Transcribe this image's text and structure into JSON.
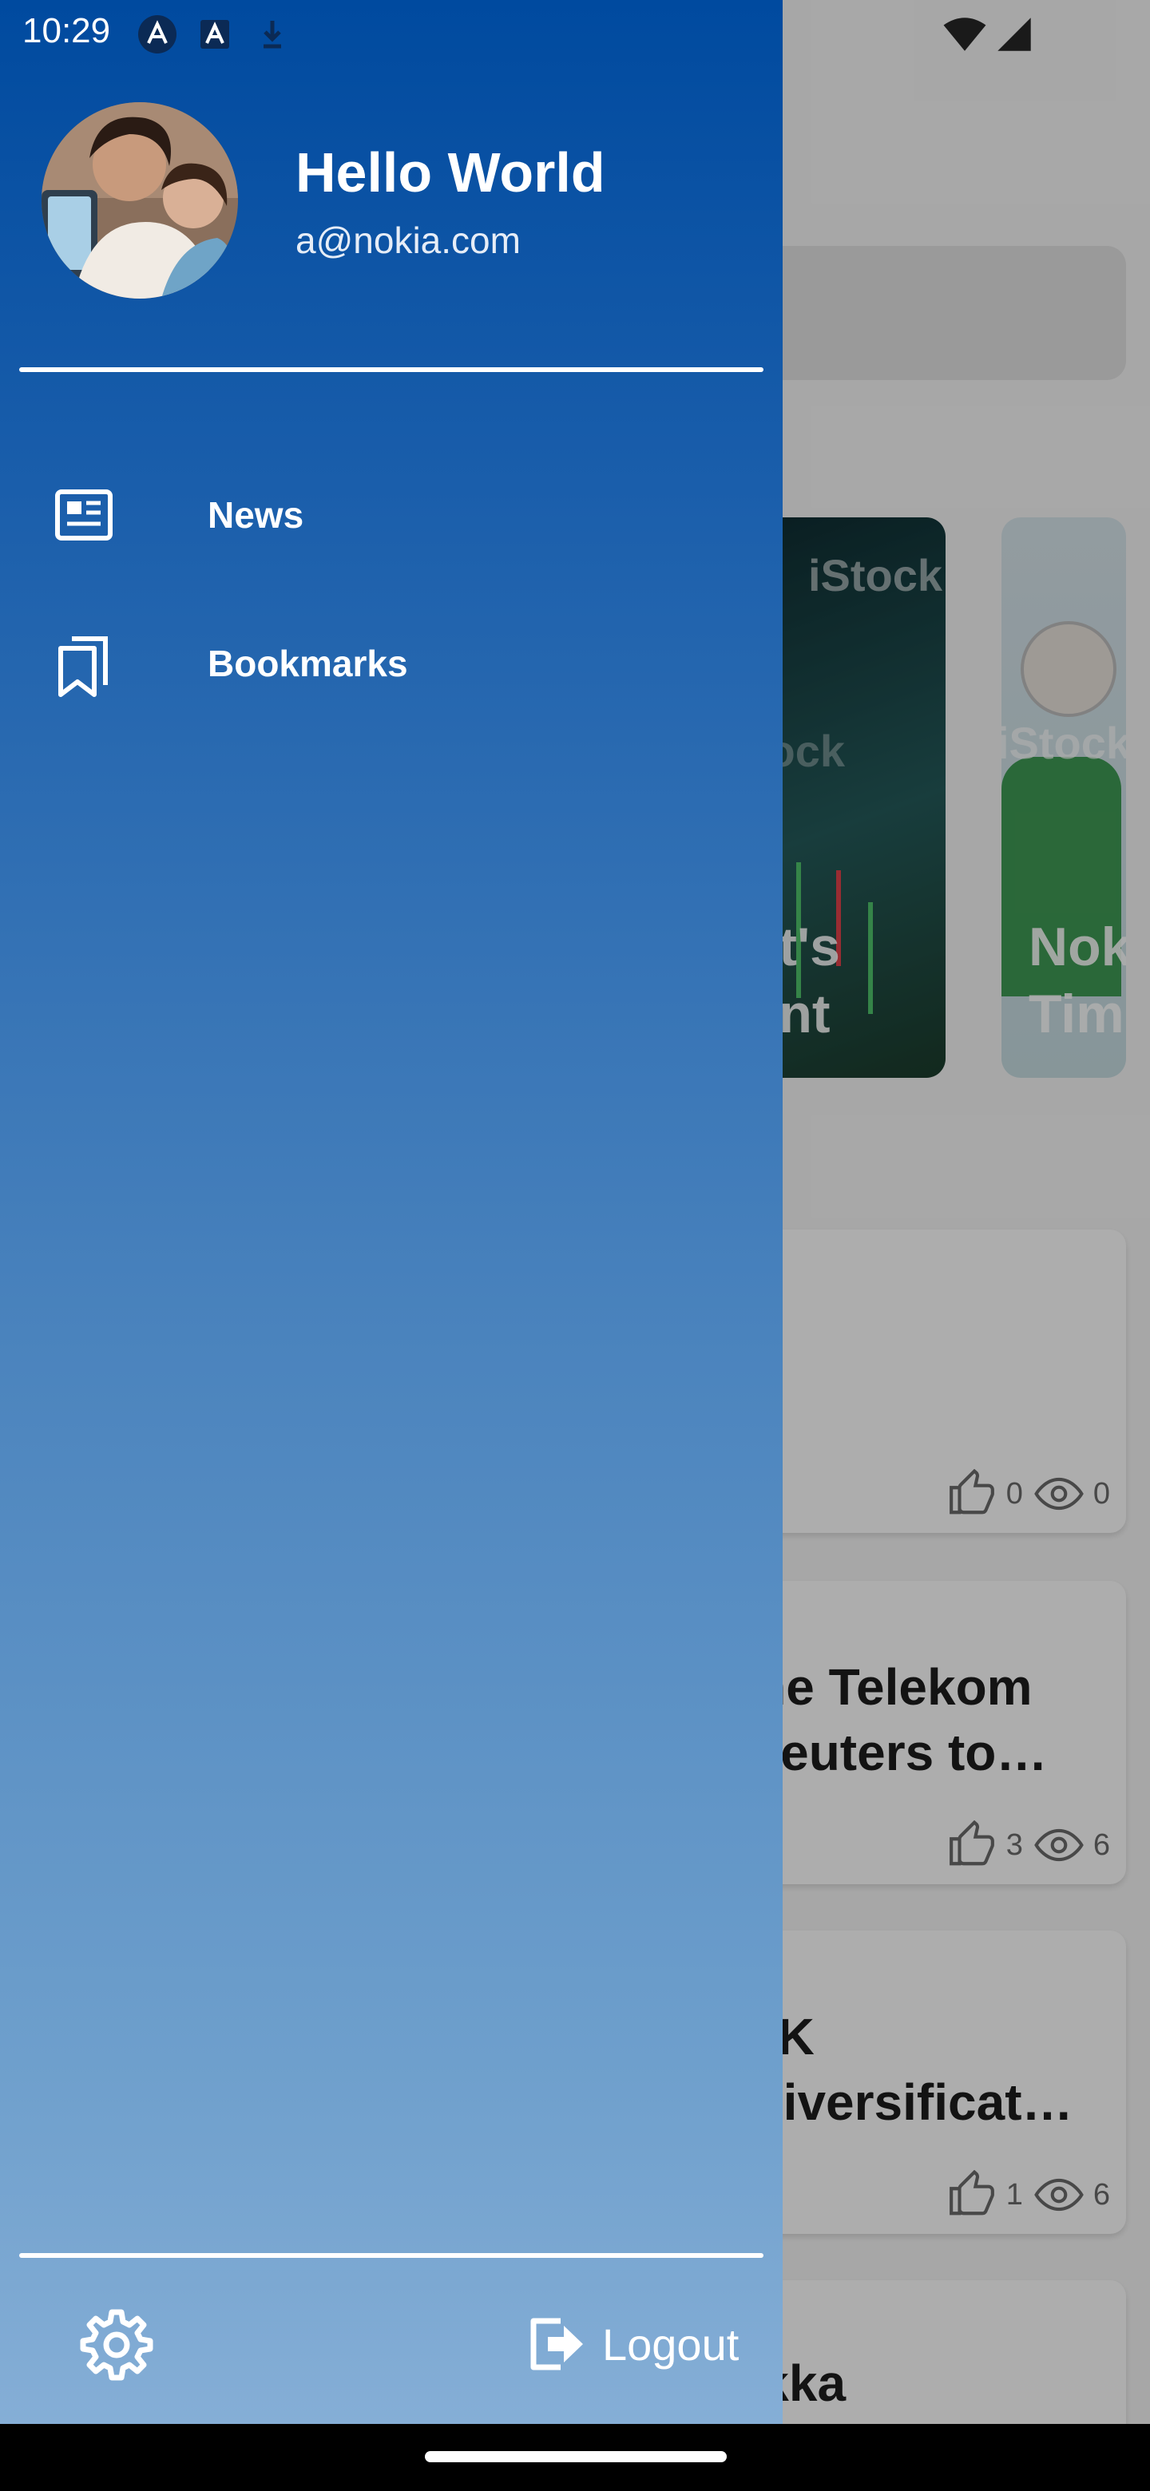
{
  "status_bar": {
    "time": "10:29",
    "left_icons": [
      "app-notification-icon",
      "text-notification-icon",
      "download-notification-icon"
    ],
    "right_icons": [
      "wifi-icon",
      "cell-signal-icon"
    ]
  },
  "drawer": {
    "user": {
      "name": "Hello World",
      "email": "a@nokia.com",
      "avatar_icon": "profile-photo"
    },
    "items": [
      {
        "label": "News",
        "icon": "newspaper-icon"
      },
      {
        "label": "Bookmarks",
        "icon": "bookmarks-icon"
      }
    ],
    "footer": {
      "settings_icon": "gear-icon",
      "logout_label": "Logout",
      "logout_icon": "logout-icon"
    }
  },
  "background": {
    "featured_cards": [
      {
        "watermark": "iStock",
        "text_lines": [
          "ent's",
          "nent"
        ]
      },
      {
        "watermark": "iStock",
        "text_lines": [
          "Nok",
          "Tim"
        ]
      }
    ],
    "articles": [
      {
        "title_lines": [],
        "likes": "0",
        "views": "0"
      },
      {
        "title_lines": [
          "sche Telekom",
          "n Reuters to…"
        ],
        "likes": "3",
        "views": "6"
      },
      {
        "title_lines": [
          "s UK",
          "G diversificat…"
        ],
        "likes": "1",
        "views": "6"
      },
      {
        "title_lines": [
          "Pekka"
        ],
        "likes": "",
        "views": ""
      }
    ]
  },
  "colors": {
    "drawer_top": "#004a9f",
    "drawer_bottom": "#85aed6",
    "text_on_drawer": "#ffffff"
  }
}
